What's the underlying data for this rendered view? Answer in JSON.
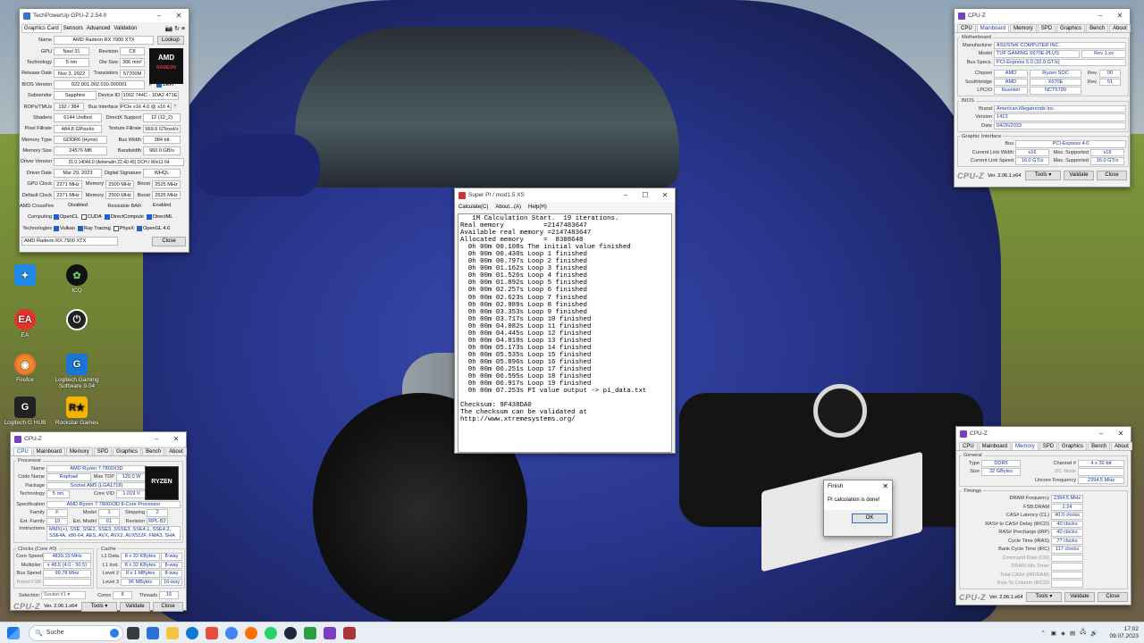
{
  "gpuz": {
    "title": "TechPowerUp GPU-Z 2.54.0",
    "tabs": [
      "Graphics Card",
      "Sensors",
      "Advanced",
      "Validation"
    ],
    "lookup": "Lookup",
    "name": "AMD Radeon RX 7900 XTX",
    "gpu": "Navi 31",
    "revision": "C8",
    "technology": "5 nm",
    "die_size": "306 mm²",
    "release_date": "Nov 3, 2022",
    "transistors": "57700M",
    "bios": "022.001.002.010.000001",
    "uefi": "UEFI",
    "subvendor": "Sapphire",
    "device_id": "1002 744C - 1DA2 471E",
    "rops_tmus": "192 / 384",
    "bus_interface": "PCIe x16 4.0 @ x16 4.0",
    "shaders": "6144 Unified",
    "directx": "12 (12_2)",
    "pixel_fillrate": "484.8 GPixel/s",
    "texture_fillrate": "969.6 GTexel/s",
    "memory_type": "GDDR6 (Hynix)",
    "bus_width": "384 bit",
    "memory_size": "24576 MB",
    "bandwidth": "960.0 GB/s",
    "driver_version": "31.0.14046.0 (Adrenalin 22.40.45) DCH / Win11 64",
    "driver_date": "Mar 29, 2023",
    "digital_signature": "WHQL",
    "gpu_clock": "2371 MHz",
    "memory_clock": "2500 MHz",
    "boost": "2525 MHz",
    "default_clock": "2371 MHz",
    "default_memory": "2500 MHz",
    "default_boost": "2525 MHz",
    "crossfire": "Disabled",
    "resizable_bar": "Enabled",
    "computing": [
      "OpenCL",
      "CUDA",
      "DirectCompute",
      "DirectML"
    ],
    "technologies": [
      "Vulkan",
      "Ray Tracing",
      "PhysX",
      "OpenGL 4.6"
    ],
    "selected_card": "AMD Radeon RX 7900 XTX",
    "close": "Close",
    "labels": {
      "name": "Name",
      "gpu": "GPU",
      "revision": "Revision",
      "technology": "Technology",
      "die_size": "Die Size",
      "release_date": "Release Date",
      "transistors": "Transistors",
      "bios": "BIOS Version",
      "subvendor": "Subvendor",
      "device_id": "Device ID",
      "rops": "ROPs/TMUs",
      "bus_interface": "Bus Interface",
      "shaders": "Shaders",
      "directx": "DirectX Support",
      "pixel": "Pixel Fillrate",
      "texture": "Texture Fillrate",
      "memory_type": "Memory Type",
      "bus_width": "Bus Width",
      "memory_size": "Memory Size",
      "bandwidth": "Bandwidth",
      "driver_version": "Driver Version",
      "driver_date": "Driver Date",
      "digsig": "Digital Signature",
      "gpu_clock": "GPU Clock",
      "memory": "Memory",
      "boost": "Boost",
      "default_clock": "Default Clock",
      "crossfire": "AMD CrossFire",
      "rebar": "Resizable BAR",
      "computing": "Computing",
      "technologies": "Technologies"
    }
  },
  "cpuz_mb": {
    "title": "CPU-Z",
    "tabs": [
      "CPU",
      "Mainboard",
      "Memory",
      "SPD",
      "Graphics",
      "Bench",
      "About"
    ],
    "legend_mb": "Motherboard",
    "manufacturer": "ASUSTeK COMPUTER INC.",
    "model": "TUF GAMING X670E-PLUS",
    "model_rev": "Rev 1.xx",
    "bus_specs": "PCI-Express 5.0 (32.0 GT/s)",
    "chipset_vendor": "AMD",
    "chipset": "Ryzen SOC",
    "chipset_rev": "00",
    "south_vendor": "AMD",
    "southbridge": "X670E",
    "south_rev": "51",
    "lpcio_vendor": "Nuvoton",
    "lpcio": "NCT6799",
    "legend_bios": "BIOS",
    "brand": "American Megatrends Inc.",
    "version": "1413",
    "date": "04/26/2023",
    "legend_gi": "Graphic Interface",
    "gi_bus": "PCI-Express 4.0",
    "link_width": "x16",
    "max_width": "x16",
    "link_speed": "16.0 GT/s",
    "max_speed": "16.0 GT/s",
    "labels": {
      "manufacturer": "Manufacturer",
      "model": "Model",
      "bus_specs": "Bus Specs.",
      "chipset": "Chipset",
      "southbridge": "Southbridge",
      "lpcio": "LPCIO",
      "rev": "Rev.",
      "brand": "Brand",
      "version": "Version",
      "date": "Date",
      "bus": "Bus",
      "link_width": "Current Link Width",
      "max_supported": "Max. Supported",
      "link_speed": "Current Link Speed"
    },
    "footer": {
      "ver": "Ver. 2.06.1.x64",
      "tools": "Tools",
      "validate": "Validate",
      "close": "Close"
    }
  },
  "superpi": {
    "title": "Super PI / mod1.5 XS",
    "menu": [
      "Calculate(C)",
      "About...(A)",
      "Help(H)"
    ],
    "lines": [
      "   1M Calculation Start.  19 iterations.",
      "Real memory          =2147483647",
      "Available real memory =2147483647",
      "Allocated memory     =  8388648",
      "  0h 00m 00.108s The initial value finished",
      "  0h 00m 00.430s Loop 1 finished",
      "  0h 00m 00.797s Loop 2 finished",
      "  0h 00m 01.162s Loop 3 finished",
      "  0h 00m 01.526s Loop 4 finished",
      "  0h 00m 01.892s Loop 5 finished",
      "  0h 00m 02.257s Loop 6 finished",
      "  0h 00m 02.623s Loop 7 finished",
      "  0h 00m 02.989s Loop 8 finished",
      "  0h 00m 03.353s Loop 9 finished",
      "  0h 00m 03.717s Loop 10 finished",
      "  0h 00m 04.082s Loop 11 finished",
      "  0h 00m 04.445s Loop 12 finished",
      "  0h 00m 04.810s Loop 13 finished",
      "  0h 00m 05.173s Loop 14 finished",
      "  0h 00m 05.535s Loop 15 finished",
      "  0h 00m 05.896s Loop 16 finished",
      "  0h 00m 06.251s Loop 17 finished",
      "  0h 00m 06.595s Loop 18 finished",
      "  0h 00m 06.917s Loop 19 finished",
      "  0h 00m 07.253s PI value output -> pi_data.txt",
      "",
      "Checksum: 9F438DA0",
      "The checksum can be validated at",
      "http://www.xtremesystems.org/"
    ]
  },
  "finish": {
    "title": "Finish",
    "message": "PI calculation is done!",
    "ok": "OK"
  },
  "cpuz_cpu": {
    "title": "CPU-Z",
    "tabs": [
      "CPU",
      "Mainboard",
      "Memory",
      "SPD",
      "Graphics",
      "Bench",
      "About"
    ],
    "legend_proc": "Processor",
    "name": "AMD Ryzen 7 7800X3D",
    "code_name": "Raphael",
    "max_tdp": "120.0 W",
    "package": "Socket AM5 (LGA1718)",
    "technology": "5 nm",
    "core_vid": "1.019 V",
    "specification": "AMD Ryzen 7 7800X3D 8-Core Processor",
    "family": "F",
    "model": "1",
    "stepping": "2",
    "ext_family": "19",
    "ext_model": "61",
    "revision": "RPL-B2",
    "instructions": "MMX(+), SSE, SSE2, SSE3, SSSE3, SSE4.1, SSE4.2, SSE4A, x86-64, AES, AVX, AVX2, AVX512F, FMA3, SHA",
    "legend_clocks": "Clocks (Core #0)",
    "core_speed": "4839.10 MHz",
    "multiplier": "x 48.5 (4.0 - 50.5)",
    "bus_speed": "99.78 MHz",
    "rated_fsb": "",
    "legend_cache": "Cache",
    "l1d": "8 x 32 KBytes",
    "l1d_way": "8-way",
    "l1i": "8 x 32 KBytes",
    "l1i_way": "8-way",
    "l2": "8 x 1 MBytes",
    "l2_way": "8-way",
    "l3": "96 MBytes",
    "l3_way": "16-way",
    "selection": "Socket #1",
    "cores": "8",
    "threads": "16",
    "labels": {
      "name": "Name",
      "code_name": "Code Name",
      "max_tdp": "Max TDP",
      "package": "Package",
      "technology": "Technology",
      "core_vid": "Core VID",
      "specification": "Specification",
      "family": "Family",
      "model": "Model",
      "stepping": "Stepping",
      "ext_family": "Ext. Family",
      "ext_model": "Ext. Model",
      "revision": "Revision",
      "instructions": "Instructions",
      "core_speed": "Core Speed",
      "multiplier": "Multiplier",
      "bus_speed": "Bus Speed",
      "rated_fsb": "Rated FSB",
      "l1d": "L1 Data",
      "l1i": "L1 Inst.",
      "l2": "Level 2",
      "l3": "Level 3",
      "selection": "Selection",
      "cores": "Cores",
      "threads": "Threads"
    },
    "footer": {
      "ver": "Ver. 2.06.1.x64",
      "tools": "Tools",
      "validate": "Validate",
      "close": "Close"
    }
  },
  "cpuz_mem": {
    "title": "CPU-Z",
    "tabs": [
      "CPU",
      "Mainboard",
      "Memory",
      "SPD",
      "Graphics",
      "Bench",
      "About"
    ],
    "legend_general": "General",
    "type": "DDR5",
    "channel": "4 x 32-bit",
    "size": "32 GBytes",
    "dc_mode": "",
    "uncore": "2394.5 MHz",
    "legend_timings": "Timings",
    "dram_freq": "2394.5 MHz",
    "fsb_dram": "1:24",
    "cl": "40.0 clocks",
    "trcd": "40 clocks",
    "trp": "40 clocks",
    "tras": "77 clocks",
    "trc": "117 clocks",
    "labels": {
      "type": "Type",
      "channel": "Channel #",
      "size": "Size",
      "dc_mode": "DC Mode",
      "uncore": "Uncore Frequency",
      "dram_freq": "DRAM Frequency",
      "fsb_dram": "FSB:DRAM",
      "cl": "CAS# Latency (CL)",
      "trcd": "RAS# to CAS# Delay (tRCD)",
      "trp": "RAS# Precharge (tRP)",
      "tras": "Cycle Time (tRAS)",
      "trc": "Bank Cycle Time (tRC)",
      "cr": "Command Rate (CR)",
      "idle": "DRAM Idle Timer",
      "trdram": "Total CAS# (tRDRAM)",
      "trcd2": "Row To Column (tRCD)"
    },
    "footer": {
      "ver": "Ver. 2.06.1.x64",
      "tools": "Tools",
      "validate": "Validate",
      "close": "Close"
    }
  },
  "desktop_icons": [
    {
      "label": "",
      "icon": "app-blue-icon"
    },
    {
      "label": "ICQ",
      "icon": "icq-icon"
    },
    {
      "label": "EA",
      "icon": "ea-icon"
    },
    {
      "label": "",
      "icon": "power-app-icon"
    },
    {
      "label": "Firefox",
      "icon": "firefox-icon"
    },
    {
      "label": "Logitech Gaming Software 9.04",
      "icon": "logitech-icon"
    },
    {
      "label": "Logitech G HUB",
      "icon": "ghub-icon"
    },
    {
      "label": "Rockstar Games",
      "icon": "rockstar-icon"
    }
  ],
  "taskbar": {
    "search_placeholder": "Suche",
    "time": "17:02",
    "date": "09.07.2023"
  }
}
